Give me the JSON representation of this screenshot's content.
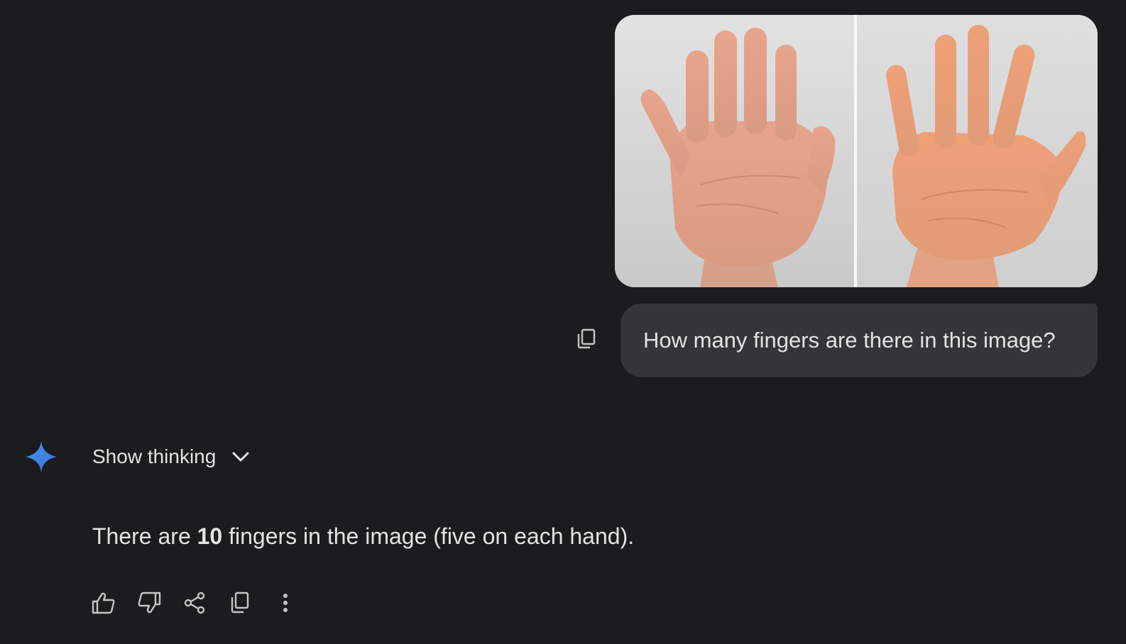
{
  "prompt": {
    "text": "How many fingers are there in this image?",
    "copy_icon": "copy-icon"
  },
  "attachment": {
    "kind": "image",
    "description_icon": "image-two-hands"
  },
  "response": {
    "show_thinking_label": "Show thinking",
    "text_before": "There are ",
    "text_bold": "10",
    "text_after": " fingers in the image (five on each hand).",
    "icons": [
      "thumbs-up-icon",
      "thumbs-down-icon",
      "share-icon",
      "copy-icon",
      "more-vert-icon"
    ]
  },
  "colors": {
    "background": "#1b1c1d",
    "bubble": "#333537",
    "text": "#e3e3e3",
    "icon": "#c4c7c5",
    "gemini_blue": "#4285f4"
  }
}
